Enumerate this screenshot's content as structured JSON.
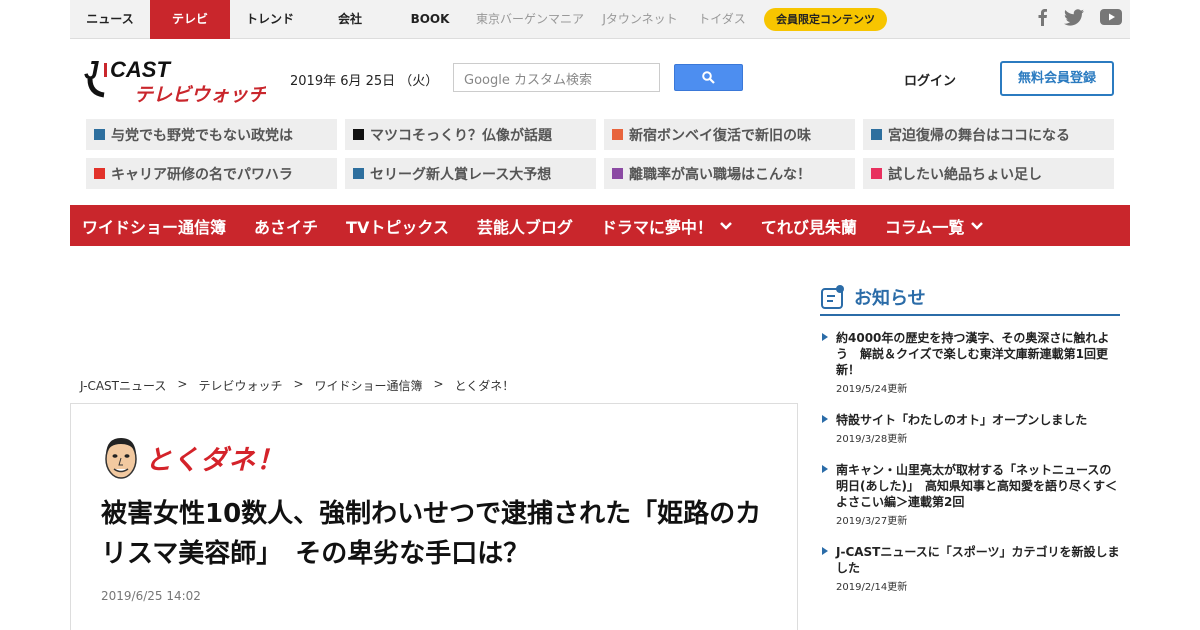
{
  "topnav": {
    "items": [
      "ニュース",
      "テレビ",
      "トレンド",
      "会社",
      "BOOK"
    ],
    "active_index": 1,
    "sub_items": [
      "東京バーゲンマニア",
      "Jタウンネット",
      "トイダス"
    ],
    "member_label": "会員限定コンテンツ",
    "social": [
      "facebook-icon",
      "twitter-icon",
      "youtube-icon"
    ]
  },
  "header": {
    "logo_top": "J-CAST",
    "logo_bottom": "テレビウォッチ",
    "date": "2019年 6月 25日 （火）",
    "search_placeholder": "Google カスタム検索",
    "login_label": "ログイン",
    "register_label": "無料会員登録"
  },
  "topics": [
    {
      "label": "与党でも野党でもない政党は",
      "color": "#2e6f9e"
    },
    {
      "label": "マツコそっくり？仏像が話題",
      "color": "#111111"
    },
    {
      "label": "新宿ボンベイ復活で新旧の味",
      "color": "#e8643c"
    },
    {
      "label": "宮迫復帰の舞台はココになる",
      "color": "#2e6f9e"
    },
    {
      "label": "キャリア研修の名でパワハラ",
      "color": "#e2322a"
    },
    {
      "label": "セリーグ新人賞レース大予想",
      "color": "#2e6f9e"
    },
    {
      "label": "離職率が高い職場はこんな！",
      "color": "#8b4aa3"
    },
    {
      "label": "試したい絶品ちょい足し",
      "color": "#e8305e"
    }
  ],
  "menu": [
    {
      "label": "ワイドショー通信簿",
      "dropdown": false
    },
    {
      "label": "あさイチ",
      "dropdown": false
    },
    {
      "label": "TVトピックス",
      "dropdown": false
    },
    {
      "label": "芸能人ブログ",
      "dropdown": false
    },
    {
      "label": "ドラマに夢中！",
      "dropdown": true
    },
    {
      "label": "てれび見朱蘭",
      "dropdown": false
    },
    {
      "label": "コラム一覧",
      "dropdown": true
    }
  ],
  "breadcrumb": [
    "J-CASTニュース",
    "テレビウォッチ",
    "ワイドショー通信簿",
    "とくダネ！"
  ],
  "breadcrumb_sep": ">",
  "article": {
    "show_name": "とくダネ！",
    "headline": "被害女性10数人、強制わいせつで逮捕された「姫路のカリスマ美容師」　その卑劣な手口は？",
    "date": "2019/6/25 14:02"
  },
  "sidebar": {
    "title": "お知らせ",
    "news": [
      {
        "title": "約4000年の歴史を持つ漢字、その奥深さに触れよう　解説＆クイズで楽しむ東洋文庫新連載第1回更新！",
        "date": "2019/5/24更新"
      },
      {
        "title": "特設サイト「わたしのオト」オープンしました",
        "date": "2019/3/28更新"
      },
      {
        "title": "南キャン・山里亮太が取材する「ネットニュースの明日(あした)」　高知県知事と高知愛を語り尽くす＜よさこい編＞連載第2回",
        "date": "2019/3/27更新"
      },
      {
        "title": "J-CASTニュースに「スポーツ」カテゴリを新設しました",
        "date": "2019/2/14更新"
      }
    ]
  }
}
